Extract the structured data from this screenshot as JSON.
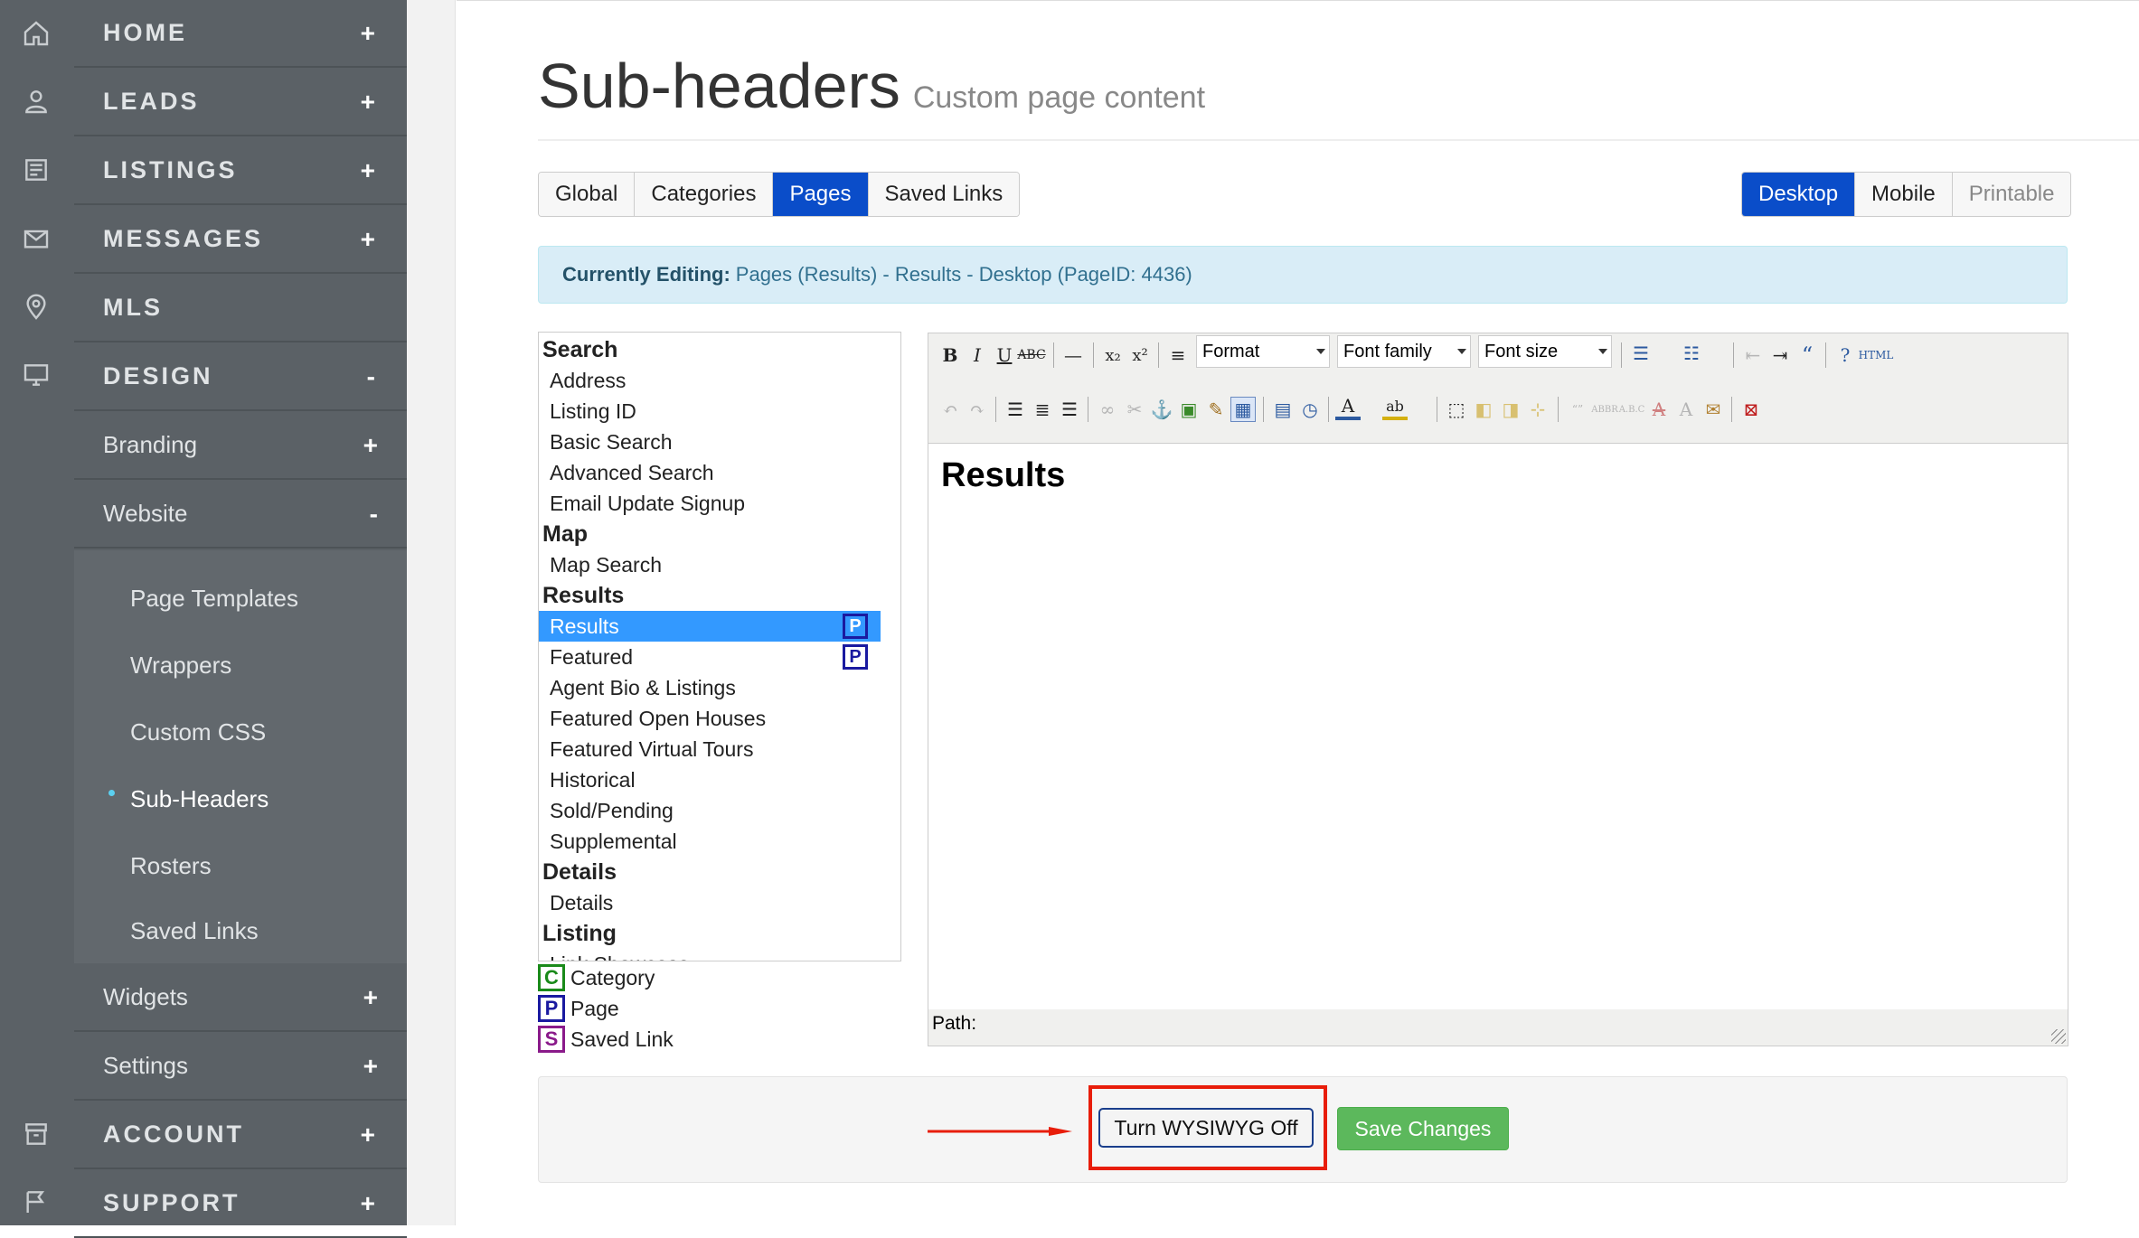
{
  "rail": {
    "icons": [
      "home-icon",
      "user-icon",
      "newspaper-icon",
      "envelope-icon",
      "map-pin-icon",
      "monitor-icon",
      "archive-icon",
      "flag-icon"
    ]
  },
  "nav": {
    "home": "HOME",
    "leads": "LEADS",
    "listings": "LISTINGS",
    "messages": "MESSAGES",
    "mls": "MLS",
    "design": "DESIGN",
    "branding": "Branding",
    "website": "Website",
    "widgets": "Widgets",
    "settings": "Settings",
    "account": "ACCOUNT",
    "support": "SUPPORT",
    "plus": "+",
    "minus": "-",
    "website_sub": {
      "page_templates": "Page Templates",
      "wrappers": "Wrappers",
      "custom_css": "Custom CSS",
      "sub_headers": "Sub-Headers",
      "rosters": "Rosters",
      "saved_links": "Saved Links"
    }
  },
  "page": {
    "title": "Sub-headers",
    "subtitle": "Custom page content"
  },
  "tabs": {
    "global": "Global",
    "categories": "Categories",
    "pages": "Pages",
    "saved_links": "Saved Links",
    "active": "Pages"
  },
  "view_tabs": {
    "desktop": "Desktop",
    "mobile": "Mobile",
    "printable": "Printable",
    "active": "Desktop"
  },
  "alert": {
    "label": "Currently Editing:",
    "text": "Pages (Results) - Results - Desktop (PageID: 4436)"
  },
  "tree": {
    "search": "Search",
    "address": "Address",
    "listing_id": "Listing ID",
    "basic_search": "Basic Search",
    "advanced_search": "Advanced Search",
    "email_update_signup": "Email Update Signup",
    "map": "Map",
    "map_search": "Map Search",
    "results": "Results",
    "results_leaf": "Results",
    "featured": "Featured",
    "agent_bio": "Agent Bio & Listings",
    "featured_open_houses": "Featured Open Houses",
    "featured_virtual_tours": "Featured Virtual Tours",
    "historical": "Historical",
    "sold_pending": "Sold/Pending",
    "supplemental": "Supplemental",
    "details": "Details",
    "details_leaf": "Details",
    "listing": "Listing",
    "link_showcase": "Link Showcase",
    "badge_p": "P"
  },
  "legend": {
    "category_key": "C",
    "category": "Category",
    "page_key": "P",
    "page": "Page",
    "saved_key": "S",
    "saved_link": "Saved Link"
  },
  "editor": {
    "format": "Format",
    "font_family": "Font family",
    "font_size": "Font size",
    "content_heading": "Results",
    "path_label": "Path:"
  },
  "footer": {
    "wysiwyg_button": "Turn WYSIWYG Off",
    "save_button": "Save Changes"
  },
  "colors": {
    "sidebar": "#5b6166",
    "primary": "#0a4dc9",
    "selection": "#3399ff",
    "success": "#5cb85c",
    "annotation": "#e81d0a",
    "info_bg": "#d9edf7"
  }
}
